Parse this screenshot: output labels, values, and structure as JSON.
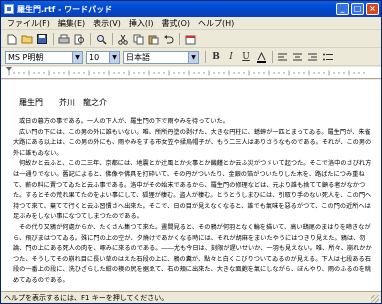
{
  "window": {
    "title": "羅生門.rtf - ワードパッド",
    "minimize": "_",
    "maximize": "□",
    "close": "×"
  },
  "menu": {
    "items": [
      "ファイル(F)",
      "編集(E)",
      "表示(V)",
      "挿入(I)",
      "書式(O)",
      "ヘルプ(H)"
    ]
  },
  "toolbar": {
    "new": "new-document-icon",
    "open": "open-folder-icon",
    "save": "save-icon",
    "print": "print-icon",
    "preview": "print-preview-icon",
    "find": "find-icon",
    "cut": "cut-icon",
    "copy": "copy-icon",
    "paste": "paste-icon",
    "undo": "undo-icon",
    "datetime": "date-time-icon"
  },
  "format_bar": {
    "font": "MS P明朝",
    "size": "10",
    "script": "日本語",
    "bold": "B",
    "italic": "I",
    "underline": "U"
  },
  "document": {
    "heading": "羅生門　　芥川　龍之介",
    "paragraphs": [
      "或日の暮方の事である。一人の下人が、羅生門の下で雨やみを待っていた。",
      "広い門の下には、この男の外に誰もいない。唯、所所丹塗の剥げた、大きな円柱に、蟋蟀が一匹とまってゐる。羅生門が、朱雀大路にある以上は、この男の外にも、雨やみをする市女笠や揉烏帽子が、もう二三人はありさうなものである。それが、この男の外に誰もゐない。",
      "何故かと云ふと、この二三年、京都には、地震とか辻風とか火事とか饑饉とか云ふ災がつゞいて起つた。そこで洛中のさびれ方は一通りでない。舊記によると、佛像や佛具を打砕いて、その丹がついたり、金銀の箔がついたりした木を、路ばたにつみ重ねて、薪の料に賣つてゐたと云ふ事である。洛中がその始末であるから、羅生門の修理などは、元より誰も捨てて顧る者がなかつた。するとその荒れ果てたのをよい事にして、狐狸が棲む。盗人が棲む。とうとうしまひには、引取り手のない死人を、この門へ持つて來て、棄てて行くと云ふ習慣さへ出來た。そこで、日の目が見えなくなると、誰でも氣味を惡るがつて、この門の近所へは足ぶみをしない事になつてしまつたのである。",
      "その代り又鴉が何處からか、たくさん集つて來た。晝間見ると、その鴉が何羽となく輪を描いて、高い鴟尾のまはりを啼きながら、飛びまはつてゐる。殊に門の上の空が、夕燒けであかくなる時には、それが胡麻をまいたやうにはつきり見えた。鴉は、勿論、門の上にある死人の肉を、啄みに來るのである。――尤も今日は、刻限が遅いせいか、一羽も見えない。唯、所々、崩れかかつた、そうしてその崩れ目に長い草のはえた石段の上に、鴉の糞が、點々と白くこびりついてゐるのが見える。下人は七段ある石段の一番上の段に、洗ひざらした紺の襖の尻を据ゑて、右の頬に出來た、大きな面皰を氣にしながら、ぼんやり、雨のふるのを眺めてゐるのである。"
    ]
  },
  "status": {
    "text": "ヘルプを表示するには、F1 キーを押してください。"
  }
}
